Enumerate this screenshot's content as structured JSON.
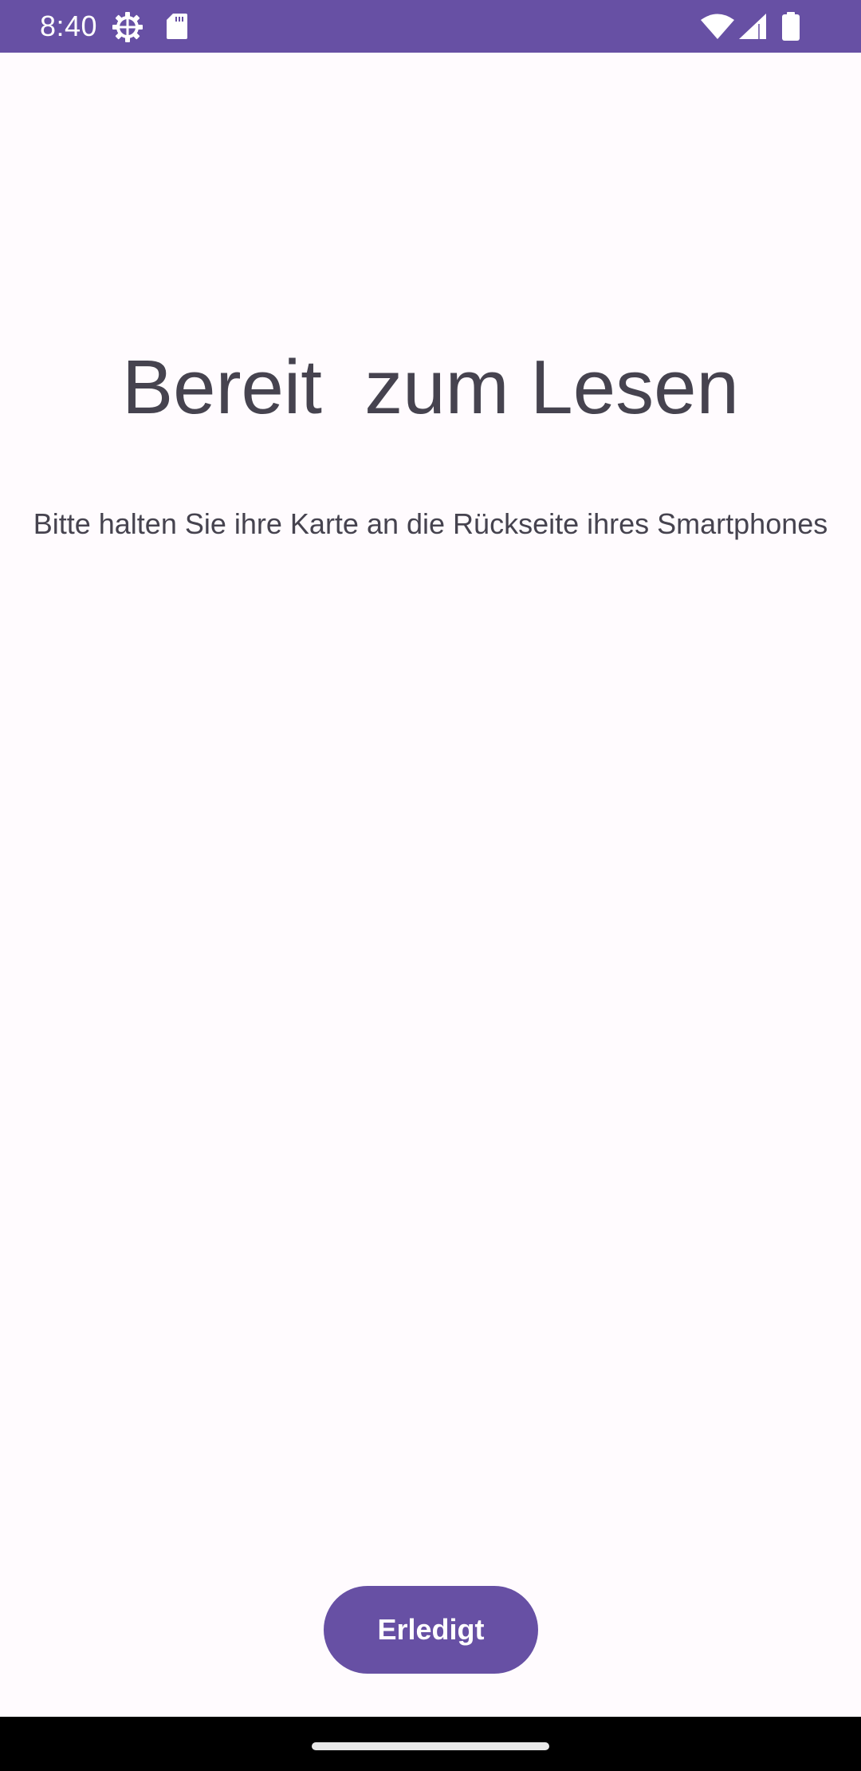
{
  "status_bar": {
    "time": "8:40",
    "background": "#6750a4",
    "icons": [
      "settings-icon",
      "sd-card-icon",
      "wifi-icon",
      "signal-icon",
      "battery-icon"
    ]
  },
  "screen": {
    "title": "Bereit  zum Lesen",
    "instruction": "Bitte halten Sie ihre Karte an die Rückseite ihres Smartphones"
  },
  "actions": {
    "done_label": "Erledigt"
  },
  "colors": {
    "accent": "#6750a4",
    "text": "#46434f",
    "background": "#fffbfe"
  }
}
